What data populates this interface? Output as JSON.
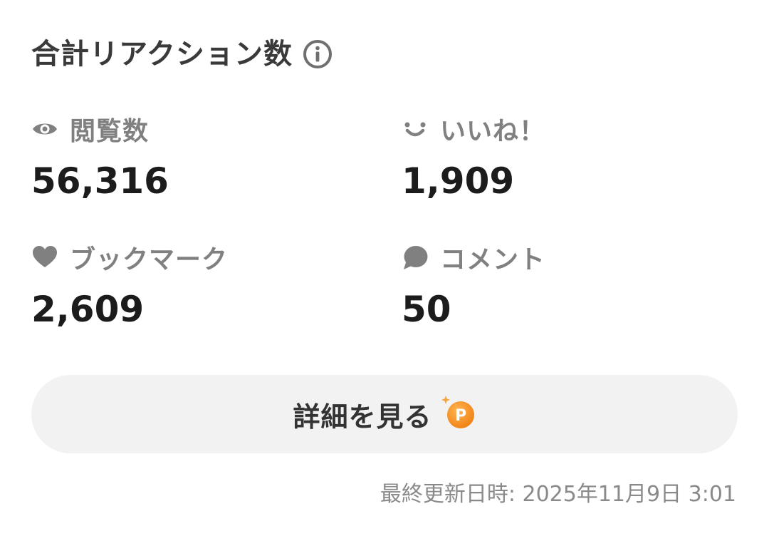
{
  "header": {
    "title": "合計リアクション数",
    "info_icon": "info-circle-icon"
  },
  "stats": [
    {
      "label": "閲覧数",
      "value": "56,316",
      "icon": "eye-icon"
    },
    {
      "label": "いいね！",
      "value": "1,909",
      "icon": "smile-icon"
    },
    {
      "label": "ブックマーク",
      "value": "2,609",
      "icon": "heart-icon"
    },
    {
      "label": "コメント",
      "value": "50",
      "icon": "speech-bubble-icon"
    }
  ],
  "detail_button": {
    "label": "詳細を見る",
    "badge_icon": "points-badge-icon",
    "badge_letter": "P"
  },
  "footer": {
    "last_updated": "最終更新日時: 2025年11月9日 3:01"
  },
  "colors": {
    "label_gray": "#808080",
    "value_dark": "#1c1c1c",
    "button_bg": "#f2f2f2",
    "badge_orange": "#f5962a"
  }
}
